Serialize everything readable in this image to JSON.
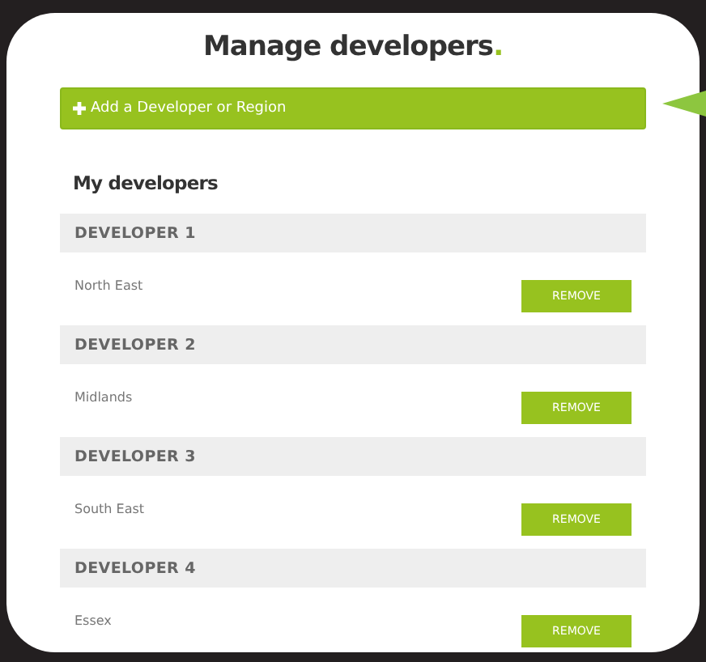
{
  "title": "Manage developers",
  "title_mark": ".",
  "add_button": {
    "label": "Add a Developer or Region"
  },
  "section_title": "My developers",
  "developers": [
    {
      "name": "DEVELOPER 1",
      "region": "North East",
      "action": "REMOVE"
    },
    {
      "name": "DEVELOPER 2",
      "region": "Midlands",
      "action": "REMOVE"
    },
    {
      "name": "DEVELOPER 3",
      "region": "South East",
      "action": "REMOVE"
    },
    {
      "name": "DEVELOPER 4",
      "region": "Essex",
      "action": "REMOVE"
    }
  ]
}
